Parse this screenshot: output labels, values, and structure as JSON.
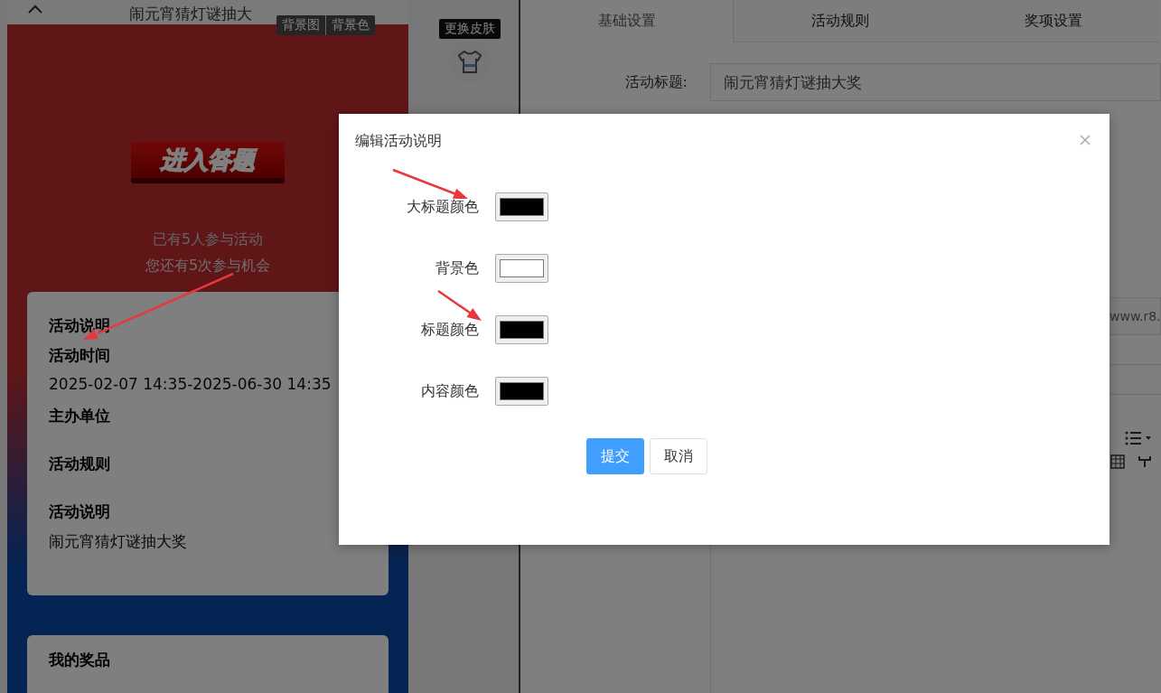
{
  "phone": {
    "header_title": "闹元宵猜灯谜抽大",
    "bg_buttons": [
      "背景图",
      "背景色"
    ],
    "start_button": "进入答题",
    "participants": "已有5人参与活动",
    "chances": "您还有5次参与机会",
    "info_card": {
      "heading": "活动说明",
      "sections": [
        {
          "title": "活动时间",
          "content": "2025-02-07 14:35-2025-06-30 14:35"
        },
        {
          "title": "主办单位"
        },
        {
          "title": "活动规则"
        },
        {
          "title": "活动说明",
          "content": "闹元宵猜灯谜抽大奖"
        }
      ]
    },
    "prizes_card": {
      "heading": "我的奖品"
    }
  },
  "skin": {
    "tooltip": "更换皮肤"
  },
  "tabs": [
    {
      "label": "基础设置",
      "selected": true
    },
    {
      "label": "活动规则",
      "selected": false
    },
    {
      "label": "奖项设置",
      "selected": false
    }
  ],
  "form": {
    "title_label": "活动标题:",
    "title_value": "闹元宵猜灯谜抽大奖",
    "link_value": "www.r8."
  },
  "dialog": {
    "title": "编辑活动说明",
    "fields": [
      {
        "label": "大标题颜色",
        "color": "#000000"
      },
      {
        "label": "背景色",
        "color": "#ffffff"
      },
      {
        "label": "标题颜色",
        "color": "#000000"
      },
      {
        "label": "内容颜色",
        "color": "#000000"
      }
    ],
    "buttons": [
      {
        "label": "提交",
        "kind": "primary"
      },
      {
        "label": "取消",
        "kind": "default"
      }
    ]
  }
}
